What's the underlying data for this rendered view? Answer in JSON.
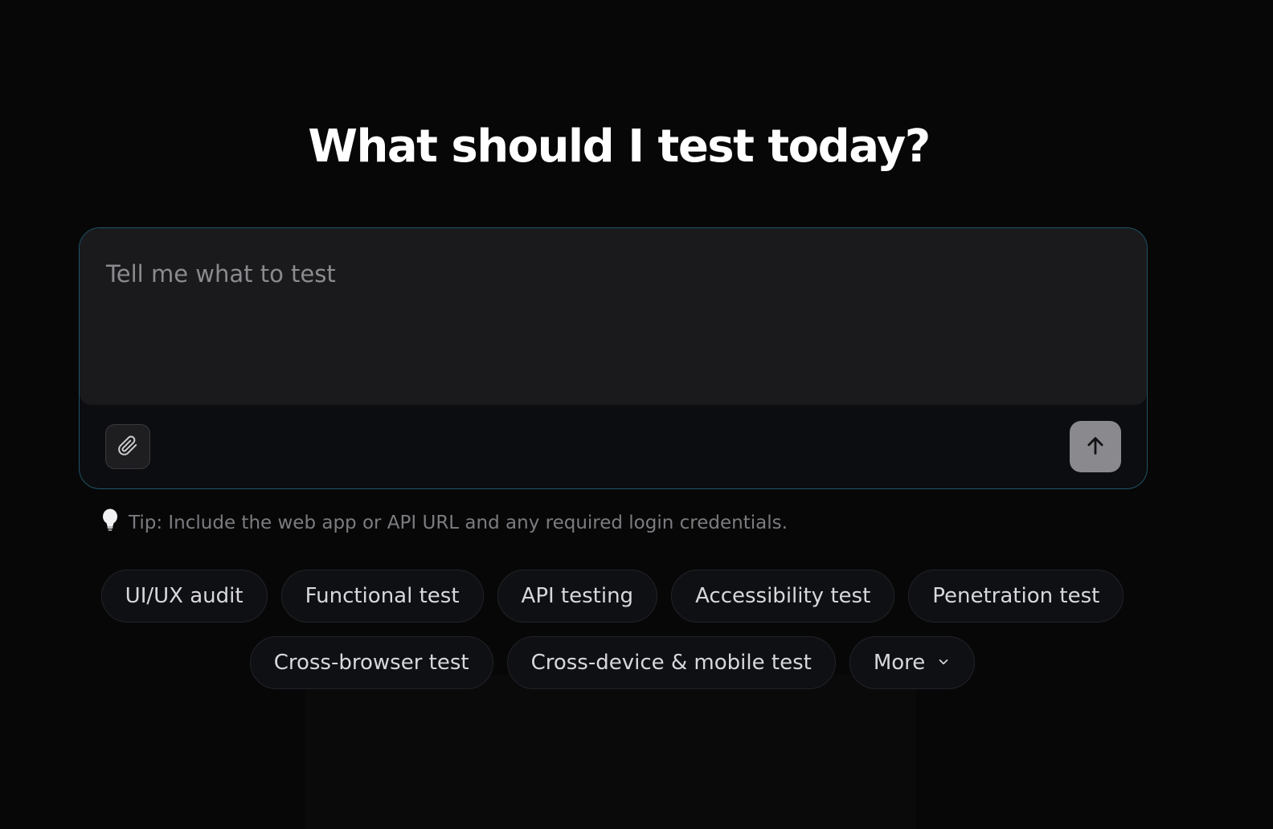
{
  "header": {
    "title": "What should I test today?"
  },
  "prompt": {
    "placeholder": "Tell me what to test",
    "value": "",
    "attach_icon": "paperclip-icon",
    "send_icon": "arrow-up-icon"
  },
  "tip": {
    "icon": "lightbulb-icon",
    "text": "Tip: Include the web app or API URL and any required login credentials."
  },
  "chips": {
    "row1": [
      "UI/UX audit",
      "Functional test",
      "API testing",
      "Accessibility test",
      "Penetration test"
    ],
    "row2": [
      "Cross-browser test",
      "Cross-device & mobile test"
    ],
    "more_label": "More",
    "more_icon": "chevron-down-icon"
  },
  "colors": {
    "background": "#070708",
    "prompt_border": "#1e5566",
    "send_button": "#8a8a8e"
  }
}
